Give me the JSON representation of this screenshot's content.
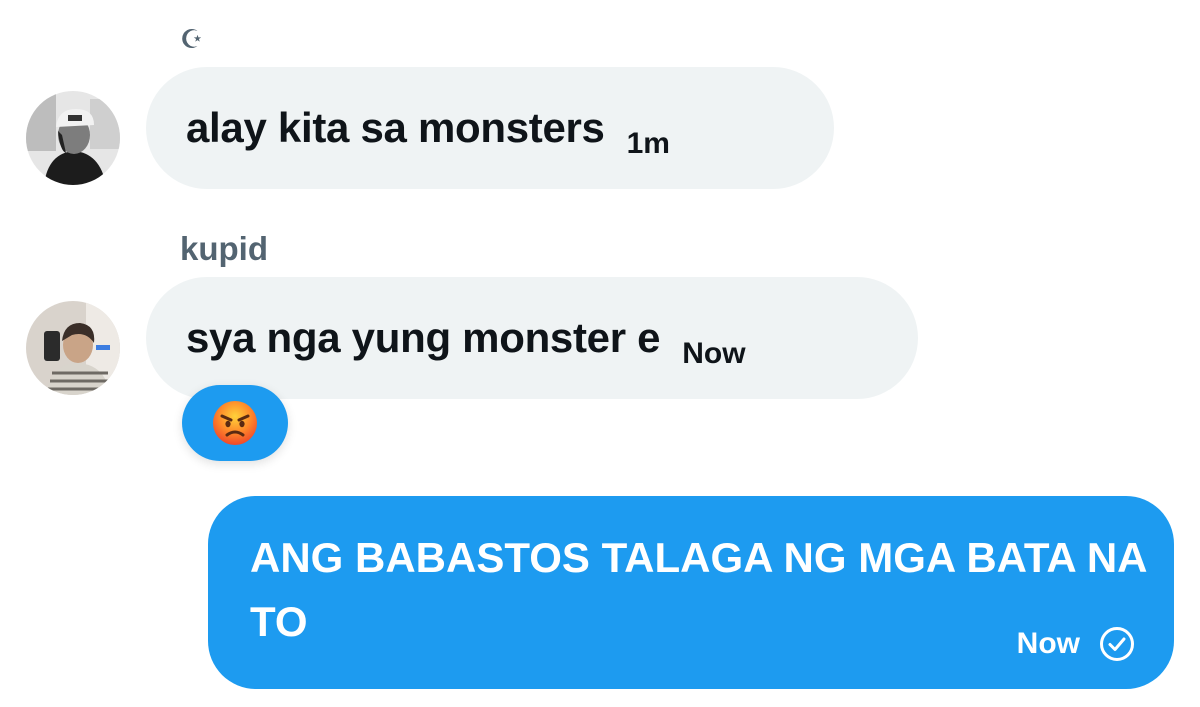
{
  "messages": [
    {
      "sender": "☪",
      "text": "alay kita sa monsters",
      "time": "1m",
      "direction": "incoming",
      "avatar_icon": "person-cap-photo-avatar"
    },
    {
      "sender": "kupid",
      "text": "sya nga yung monster e",
      "time": "Now",
      "direction": "incoming",
      "avatar_icon": "person-selfie-photo-avatar",
      "reaction": {
        "icon": "angry-face-emoji"
      }
    },
    {
      "text": "ANG BABASTOS TALAGA NG MGA BATA NA TO",
      "time": "Now",
      "direction": "outgoing",
      "status_icon": "sent-check-circle-icon"
    }
  ],
  "colors": {
    "incoming_bubble": "#eff3f4",
    "outgoing_bubble": "#1d9bf0",
    "reaction_background": "#1d9bf0",
    "sender_name": "#536471",
    "incoming_text": "#0f1419",
    "outgoing_text": "#ffffff"
  }
}
